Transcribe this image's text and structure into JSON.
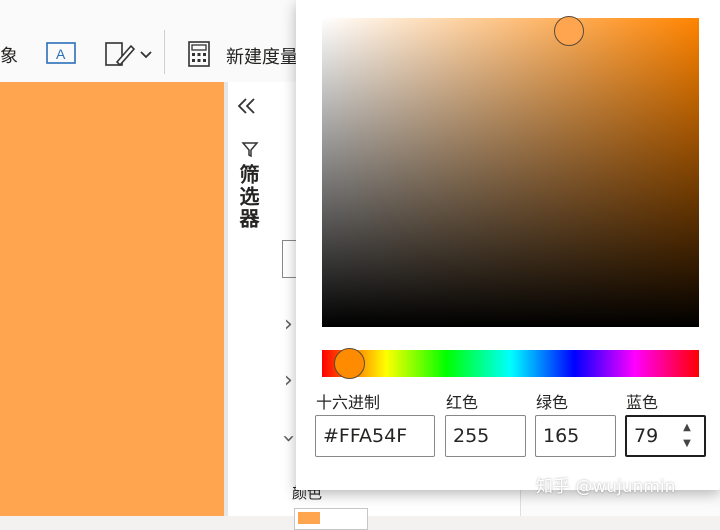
{
  "ribbon": {
    "object_label": "象",
    "new_measure_label": "新建度量"
  },
  "filter_pane": {
    "label": "筛选器"
  },
  "format_pane": {
    "section_label": "颜色"
  },
  "color_picker": {
    "selected_color": "#FFA54F",
    "hue_color": "#FF8400",
    "hex_label": "十六进制",
    "red_label": "红色",
    "green_label": "绿色",
    "blue_label": "蓝色",
    "hex_value": "#FFA54F",
    "red_value": "255",
    "green_value": "165",
    "blue_value": "79"
  },
  "watermark": "知乎 @wujunmin"
}
